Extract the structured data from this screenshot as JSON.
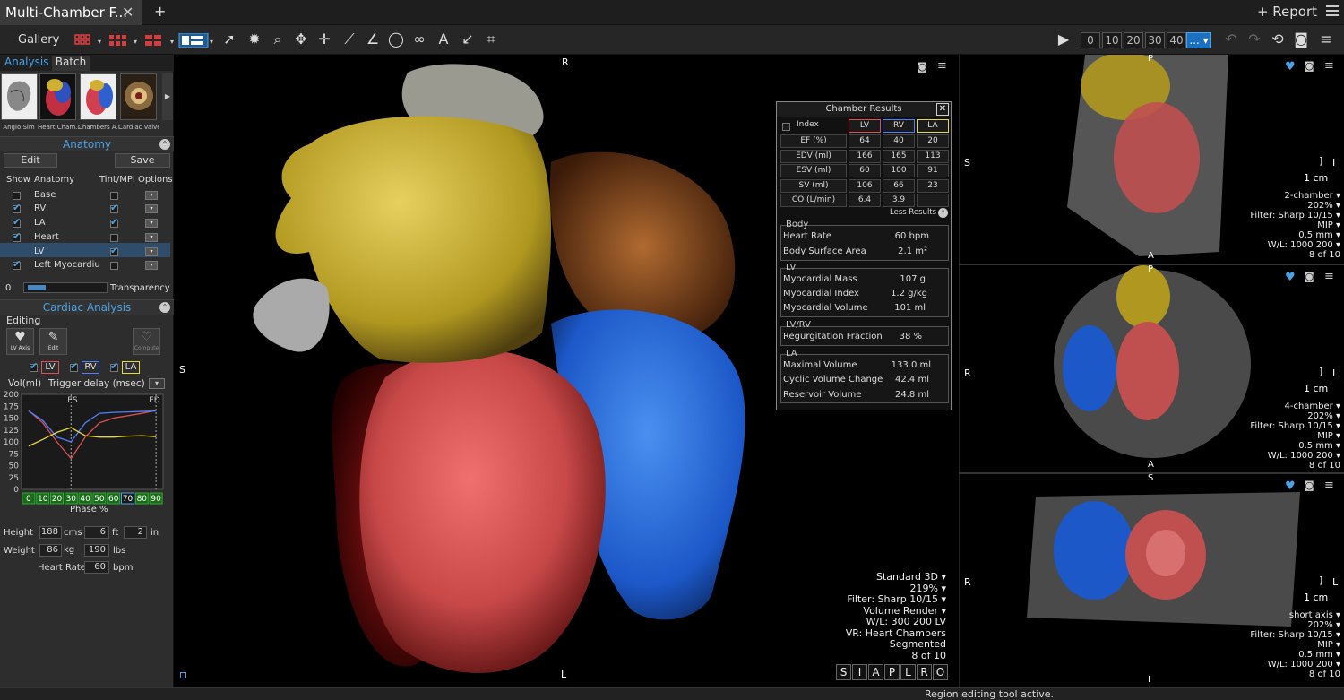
{
  "app": {
    "tab_title": "Multi-Chamber F...",
    "report_label": "+ Report"
  },
  "toolbar": {
    "gallery_label": "Gallery",
    "frame_buttons": [
      "0",
      "10",
      "20",
      "30",
      "40"
    ],
    "frame_dropdown": "..."
  },
  "left_tabs": {
    "analysis": "Analysis",
    "batch": "Batch"
  },
  "thumbnails": [
    "Angio Sim",
    "Heart Cham...",
    "Chambers A...",
    "Cardiac Valves"
  ],
  "anatomy": {
    "title": "Anatomy",
    "edit_label": "Edit",
    "save_label": "Save",
    "headers": {
      "show": "Show",
      "anatomy": "Anatomy",
      "tint": "Tint/MPI",
      "options": "Options"
    },
    "rows": [
      {
        "name": "Base",
        "show": false,
        "tint": false
      },
      {
        "name": "RV",
        "show": true,
        "tint": true
      },
      {
        "name": "LA",
        "show": true,
        "tint": true
      },
      {
        "name": "Heart",
        "show": true,
        "tint": false
      },
      {
        "name": "LV",
        "show": true,
        "tint": true
      },
      {
        "name": "Left Myocardiu",
        "show": true,
        "tint": false
      }
    ],
    "transparency_value": "0",
    "transparency_label": "Transparency"
  },
  "cardiac": {
    "title": "Cardiac Analysis",
    "editing_label": "Editing",
    "tools": [
      "LV Axis",
      "Edit",
      "Compute"
    ],
    "chambers": [
      "LV",
      "RV",
      "LA"
    ],
    "vol_label": "Vol(ml)",
    "trigger_label": "Trigger delay (msec)",
    "yticks": [
      "200",
      "175",
      "150",
      "125",
      "100",
      "75",
      "50",
      "25",
      "0"
    ],
    "es_label": "ES",
    "ed_label": "ED",
    "phases": [
      "0",
      "10",
      "20",
      "30",
      "40",
      "50",
      "60",
      "70",
      "80",
      "90"
    ],
    "phase_label": "Phase %",
    "height_label": "Height",
    "height_cm": "188",
    "cms": "cms",
    "height_ft": "6",
    "ft": "ft",
    "height_in": "2",
    "in": "in",
    "weight_label": "Weight",
    "weight_kg": "86",
    "kg": "kg",
    "weight_lbs": "190",
    "lbs": "lbs",
    "hr_label": "Heart Rate",
    "hr_value": "60",
    "bpm": "bpm"
  },
  "chart_data": {
    "type": "line",
    "x": [
      0,
      10,
      20,
      30,
      40,
      50,
      60,
      70,
      80,
      90
    ],
    "xlabel": "Phase %",
    "ylabel": "Vol(ml)",
    "ylim": [
      0,
      200
    ],
    "series": [
      {
        "name": "LV",
        "color": "#e05050",
        "values": [
          166,
          140,
          100,
          65,
          110,
          140,
          150,
          155,
          160,
          166
        ]
      },
      {
        "name": "RV",
        "color": "#5080ff",
        "values": [
          165,
          145,
          110,
          100,
          140,
          160,
          162,
          163,
          164,
          165
        ]
      },
      {
        "name": "LA",
        "color": "#e8d840",
        "values": [
          91,
          105,
          120,
          130,
          113,
          110,
          110,
          112,
          113,
          111
        ]
      }
    ]
  },
  "main_view": {
    "orient_top": "R",
    "orient_left": "S",
    "orient_bottom": "L",
    "overlay": [
      "Standard 3D ▾",
      "219% ▾",
      "Filter: Sharp 10/15 ▾",
      "Volume Render ▾",
      "W/L: 300 200 LV",
      "VR: Heart Chambers",
      "Segmented",
      "8 of 10"
    ],
    "nav": [
      "S",
      "I",
      "A",
      "P",
      "L",
      "R",
      "O"
    ]
  },
  "chamber_results": {
    "title": "Chamber Results",
    "index_label": "Index",
    "cols": [
      "LV",
      "RV",
      "LA"
    ],
    "rows": [
      {
        "label": "EF (%)",
        "vals": [
          "64",
          "40",
          "20"
        ]
      },
      {
        "label": "EDV (ml)",
        "vals": [
          "166",
          "165",
          "113"
        ]
      },
      {
        "label": "ESV (ml)",
        "vals": [
          "60",
          "100",
          "91"
        ]
      },
      {
        "label": "SV (ml)",
        "vals": [
          "106",
          "66",
          "23"
        ]
      },
      {
        "label": "CO (L/min)",
        "vals": [
          "6.4",
          "3.9",
          ""
        ]
      }
    ],
    "less_results": "Less Results",
    "body": {
      "title": "Body",
      "items": [
        {
          "label": "Heart Rate",
          "value": "60 bpm"
        },
        {
          "label": "Body Surface Area",
          "value": "2.1 m²"
        }
      ]
    },
    "lv": {
      "title": "LV",
      "items": [
        {
          "label": "Myocardial Mass",
          "value": "107 g"
        },
        {
          "label": "Myocardial Index",
          "value": "1.2 g/kg"
        },
        {
          "label": "Myocardial Volume",
          "value": "101 ml"
        }
      ]
    },
    "lvrv": {
      "title": "LV/RV",
      "items": [
        {
          "label": "Regurgitation Fraction",
          "value": "38 %"
        }
      ]
    },
    "la": {
      "title": "LA",
      "items": [
        {
          "label": "Maximal Volume",
          "value": "133.0 ml"
        },
        {
          "label": "Cyclic Volume Change",
          "value": "42.4 ml"
        },
        {
          "label": "Reservoir Volume",
          "value": "24.8 ml"
        }
      ]
    }
  },
  "side_views": [
    {
      "orient_left": "S",
      "orient_right": "I",
      "orient_top": "P",
      "orient_bottom": "A",
      "scale": "1 cm",
      "info": [
        "2-chamber ▾",
        "202% ▾",
        "Filter: Sharp 10/15 ▾",
        "MIP ▾",
        "0.5 mm ▾",
        "W/L: 1000 200 ▾",
        "8 of 10"
      ]
    },
    {
      "orient_left": "R",
      "orient_right": "L",
      "orient_top": "P",
      "orient_bottom": "A",
      "scale": "1 cm",
      "info": [
        "4-chamber ▾",
        "202% ▾",
        "Filter: Sharp 10/15 ▾",
        "MIP ▾",
        "0.5 mm ▾",
        "W/L: 1000 200 ▾",
        "8 of 10"
      ]
    },
    {
      "orient_left": "R",
      "orient_right": "L",
      "orient_top": "S",
      "orient_bottom": "I",
      "scale": "1 cm",
      "info": [
        "short axis ▾",
        "202% ▾",
        "Filter: Sharp 10/15 ▾",
        "MIP ▾",
        "0.5 mm ▾",
        "W/L: 1000 200 ▾",
        "8 of 10"
      ]
    }
  ],
  "status": "Region editing tool active."
}
